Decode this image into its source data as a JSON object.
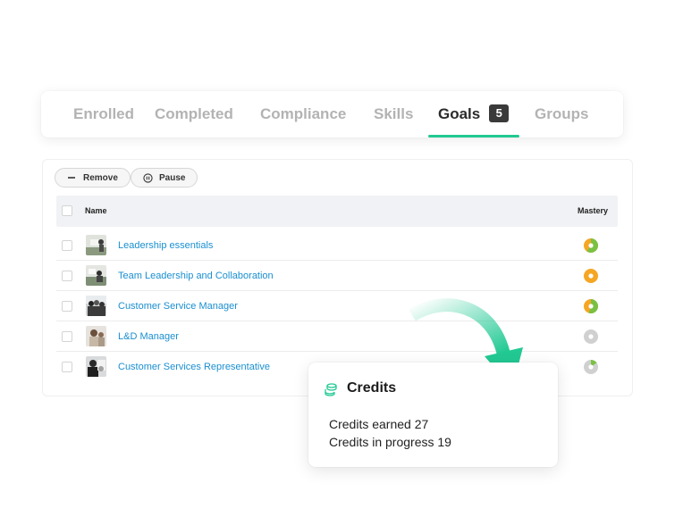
{
  "tabs": [
    {
      "label": "Enrolled",
      "active": false
    },
    {
      "label": "Completed",
      "active": false
    },
    {
      "label": "Compliance",
      "active": false
    },
    {
      "label": "Skills",
      "active": false
    },
    {
      "label": "Goals",
      "active": true,
      "count": "5"
    },
    {
      "label": "Groups",
      "active": false
    }
  ],
  "toolbar": {
    "remove_label": "Remove",
    "pause_label": "Pause"
  },
  "table": {
    "col_name": "Name",
    "col_mastery": "Mastery",
    "rows": [
      {
        "title": "Leadership essentials",
        "mastery": 0.6,
        "mastery_color": "#f5a623",
        "partial_color": "#7ac143"
      },
      {
        "title": "Team Leadership and Collaboration",
        "mastery": 1.0,
        "mastery_color": "#f5a623",
        "partial_color": "#f5a623"
      },
      {
        "title": "Customer Service Manager",
        "mastery": 0.55,
        "mastery_color": "#f5a623",
        "partial_color": "#7ac143"
      },
      {
        "title": "L&D Manager",
        "mastery": 0.0,
        "mastery_color": "#d0d0d0",
        "partial_color": "#d0d0d0"
      },
      {
        "title": "Customer Services Representative",
        "mastery": 0.15,
        "mastery_color": "#d0d0d0",
        "partial_color": "#7ac143"
      }
    ]
  },
  "credits": {
    "title": "Credits",
    "earned_line": "Credits earned 27",
    "progress_line": "Credits in progress 19"
  },
  "colors": {
    "accent": "#22c993",
    "link": "#1a8fd0",
    "tab_inactive": "#b3b3b3"
  },
  "icons": {
    "remove": "minus-icon",
    "pause": "pause-icon",
    "credits": "coins-stack-icon",
    "decor": "curved-arrow-icon"
  }
}
